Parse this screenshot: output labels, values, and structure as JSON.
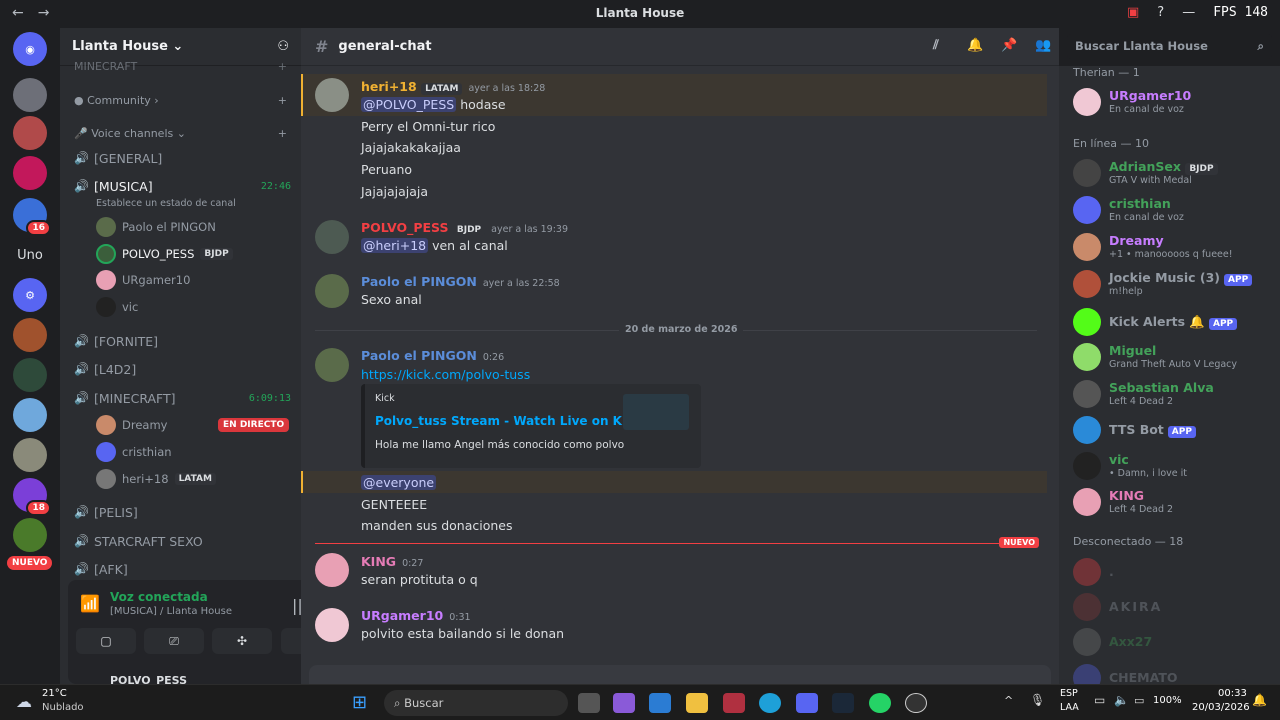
{
  "titlebar": {
    "title": "Llanta House",
    "fps": "FPS 148"
  },
  "servers": {
    "uno_label": "Uno",
    "badges": [
      "16",
      "18"
    ],
    "nuevo": "NUEVO"
  },
  "channels": {
    "server_name": "Llanta House",
    "top_cut": "MINECRAFT",
    "community": "Community",
    "voice_category": "Voice channels",
    "list": [
      {
        "name": "[GENERAL]",
        "time": ""
      },
      {
        "name": "[MUSICA]",
        "time": "22:46",
        "status": "Establece un estado de canal"
      },
      {
        "name": "[FORNITE]",
        "time": ""
      },
      {
        "name": "[L4D2]",
        "time": ""
      },
      {
        "name": "[MINECRAFT]",
        "time": "6:09:13"
      },
      {
        "name": "[PELIS]",
        "time": ""
      },
      {
        "name": "STARCRAFT SEXO",
        "time": ""
      },
      {
        "name": "[AFK]",
        "time": ""
      }
    ],
    "musica_users": [
      "Paolo el PINGON",
      "POLVO_PESS",
      "URgamer10",
      "vic"
    ],
    "musica_tag": "BJDP",
    "minecraft_users": [
      "Dreamy",
      "cristhian",
      "heri+18"
    ],
    "live": "EN DIRECTO",
    "heri_tag": "LATAM"
  },
  "voice": {
    "status": "Voz conectada",
    "location": "[MUSICA] / Llanta House",
    "user_cut": "POLVO_PESS"
  },
  "chat": {
    "channel": "general-chat",
    "search_placeholder": "Buscar Llanta House",
    "divider_date": "20 de marzo de 2026",
    "new_label": "NUEVO",
    "messages": [
      {
        "author": "heri+18",
        "tag": "LATAM",
        "time": "ayer a las 18:28",
        "lines": [
          "@POLVO_PESS hodase",
          "Perry el Omni-tur rico",
          "Jajajakakakajjaa",
          "Peruano",
          "Jajajajajaja"
        ]
      },
      {
        "author": "POLVO_PESS",
        "tag": "BJDP",
        "time": "ayer a las 19:39",
        "lines": [
          "@heri+18 ven al canal"
        ]
      },
      {
        "author": "Paolo el PINGON",
        "time": "ayer a las 22:58",
        "lines": [
          "Sexo anal"
        ]
      },
      {
        "author": "Paolo el PINGON",
        "time": "0:26",
        "lines": [
          "https://kick.com/polvo-tuss"
        ]
      },
      {
        "author": "KING",
        "time": "0:27",
        "lines": [
          "seran protituta o q"
        ]
      },
      {
        "author": "URgamer10",
        "time": "0:31",
        "lines": [
          "polvito esta bailando si le donan"
        ]
      }
    ],
    "mention1": "@POLVO_PESS",
    "mention1_rest": "hodase",
    "mention2": "@heri+18",
    "mention2_rest": "ven al canal",
    "everyone": "@everyone",
    "gente": "GENTEEEE",
    "donaciones": "manden sus donaciones",
    "embed": {
      "provider": "Kick",
      "title": "Polvo_tuss Stream - Watch Live on Kick",
      "desc": "Hola me llamo Angel más conocido como polvo"
    }
  },
  "members": {
    "therian": "Therian — 1",
    "online": "En línea — 10",
    "offline": "Desconectado — 18",
    "therian_list": [
      {
        "name": "URgamer10",
        "status": "En canal de voz"
      }
    ],
    "online_list": [
      {
        "name": "AdrianSex",
        "tag": "BJDP",
        "status": "GTA V with Medal",
        "color": "#43a25a"
      },
      {
        "name": "cristhian",
        "status": "En canal de voz",
        "color": "#43a25a"
      },
      {
        "name": "Dreamy",
        "status": "+1 • manooooos q fueee!",
        "color": "#c77dff"
      },
      {
        "name": "Jockie Music (3)",
        "app": "APP",
        "status": "m!help",
        "color": "#949ba4"
      },
      {
        "name": "Kick Alerts",
        "app": "APP",
        "status": "",
        "color": "#949ba4"
      },
      {
        "name": "Miguel",
        "status": "Grand Theft Auto V Legacy",
        "color": "#43a25a"
      },
      {
        "name": "Sebastian Alva",
        "status": "Left 4 Dead 2",
        "color": "#43a25a"
      },
      {
        "name": "TTS Bot",
        "app": "APP",
        "status": "",
        "color": "#949ba4"
      },
      {
        "name": "vic",
        "status": "• Damn, i love it",
        "color": "#43a25a"
      },
      {
        "name": "KING",
        "status": "Left 4 Dead 2",
        "color": "#e57cb6"
      }
    ],
    "offline_list": [
      ".",
      "AKIRA",
      "Axx27",
      "CHEMATO"
    ]
  },
  "taskbar": {
    "temp": "21°C",
    "weather": "Nublado",
    "search": "Buscar",
    "lang": "ESP",
    "lang2": "LAA",
    "battery": "100%",
    "time": "00:33",
    "date": "20/03/2026"
  }
}
